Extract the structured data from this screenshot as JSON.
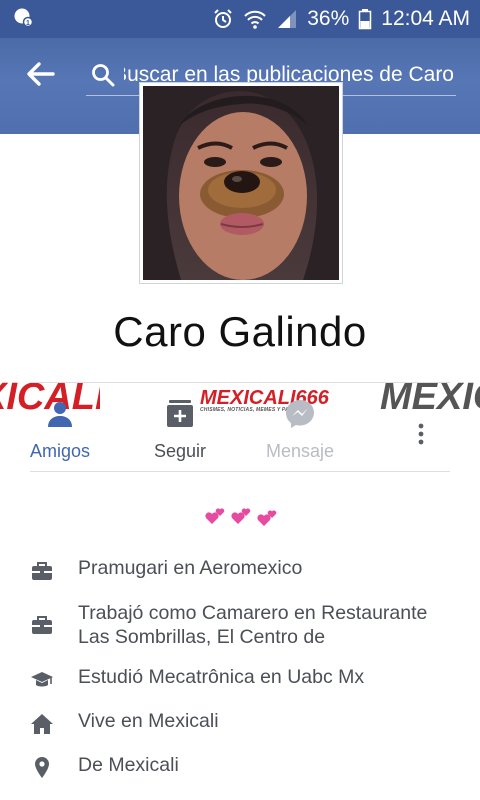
{
  "status_bar": {
    "battery_percent": "36%",
    "time": "12:04 AM"
  },
  "header": {
    "search_text": "Buscar en las publicaciones de Caro"
  },
  "profile": {
    "name": "Caro Galindo"
  },
  "watermark": {
    "brand": "MEXICALI666",
    "tagline": "CHISMES, NOTICIAS, MEMES Y PACKS"
  },
  "actions": [
    {
      "label": "Amigos",
      "state": "active"
    },
    {
      "label": "Seguir",
      "state": "normal"
    },
    {
      "label": "Mensaje",
      "state": "disabled"
    }
  ],
  "bio": {
    "emoji": "💕💕💕"
  },
  "info": [
    {
      "icon": "briefcase-icon",
      "text": "Pramugari en Aeromexico"
    },
    {
      "icon": "briefcase-icon",
      "text": "Trabajó como Camarero en Restaurante Las Sombrillas, El Centro de"
    },
    {
      "icon": "graduation-cap-icon",
      "text": "Estudió Mecatrônica en Uabc Mx"
    },
    {
      "icon": "home-icon",
      "text": "Vive en Mexicali"
    },
    {
      "icon": "location-pin-icon",
      "text": "De Mexicali"
    }
  ],
  "colors": {
    "header_blue": "#3b5998",
    "link_blue": "#4267b2",
    "watermark_red": "#d41f26"
  }
}
